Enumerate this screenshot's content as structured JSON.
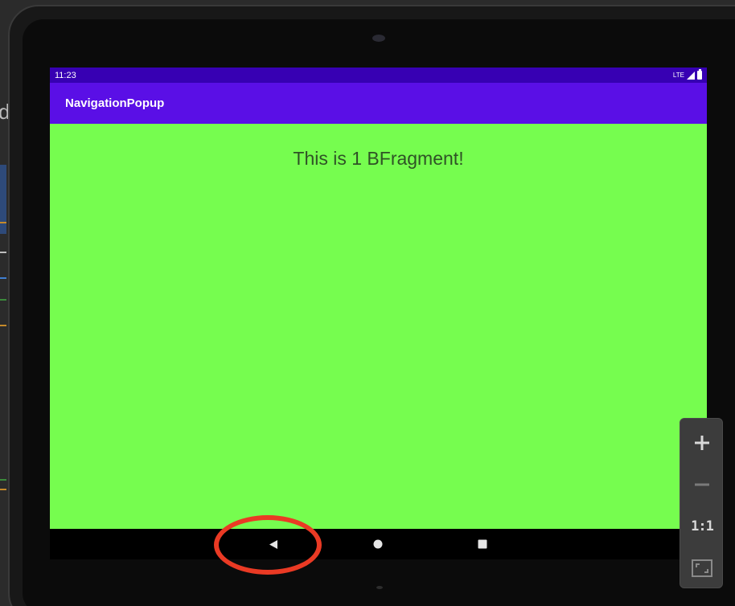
{
  "ide": {
    "visible_letter": "d"
  },
  "status_bar": {
    "time": "11:23",
    "network": "LTE"
  },
  "app_bar": {
    "title": "NavigationPopup"
  },
  "content": {
    "message": "This is 1 BFragment!"
  },
  "nav_bar": {
    "buttons": [
      "back-icon",
      "home-icon",
      "recents-icon"
    ]
  },
  "zoom_controls": {
    "actual_size_label": "1:1"
  },
  "colors": {
    "status_bar": "#3700b3",
    "app_bar": "#5a0fe6",
    "content_background": "#76fd4f",
    "annotation": "#ea3a24"
  }
}
